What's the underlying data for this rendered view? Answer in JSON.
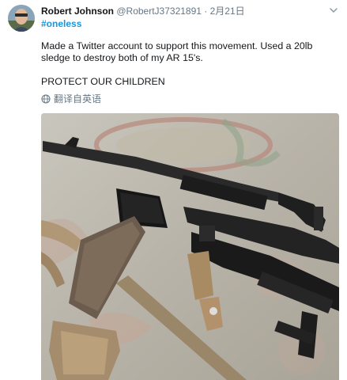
{
  "tweet": {
    "display_name": "Robert Johnson",
    "handle": "@RobertJ37321891",
    "separator": "·",
    "date": "2月21日",
    "hashtag": "#oneless",
    "body_line": "Made a Twitter account to support this movement. Used a 20lb sledge to destroy both of my AR 15's.",
    "body_line_2": "PROTECT OUR CHILDREN",
    "translate_label": "翻译自英语",
    "avatar_icon": "user-avatar",
    "menu_icon": "chevron-down-icon",
    "translate_icon": "globe-icon",
    "photo_alt": "photo"
  },
  "colors": {
    "link": "#1b95e0",
    "secondary": "#657786",
    "text": "#14171a"
  }
}
